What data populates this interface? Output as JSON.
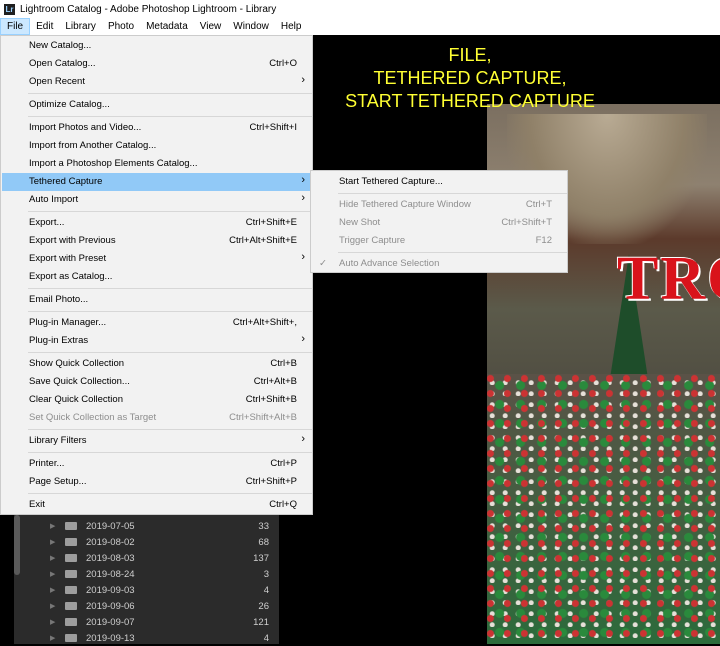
{
  "window": {
    "title": "Lightroom Catalog - Adobe Photoshop Lightroom - Library",
    "app_icon": "Lr"
  },
  "menubar": [
    {
      "label": "File"
    },
    {
      "label": "Edit"
    },
    {
      "label": "Library"
    },
    {
      "label": "Photo"
    },
    {
      "label": "Metadata"
    },
    {
      "label": "View"
    },
    {
      "label": "Window"
    },
    {
      "label": "Help"
    }
  ],
  "caption": {
    "line1": "FILE,",
    "line2": "TETHERED CAPTURE,",
    "line3": "START TETHERED CAPTURE"
  },
  "photo": {
    "banner": "TRO"
  },
  "file_menu": {
    "items": [
      {
        "label": "New Catalog...",
        "shortcut": ""
      },
      {
        "label": "Open Catalog...",
        "shortcut": "Ctrl+O"
      },
      {
        "label": "Open Recent",
        "shortcut": "",
        "submenu": "›"
      },
      {
        "label": "Optimize Catalog...",
        "shortcut": ""
      },
      {
        "label": "Import Photos and Video...",
        "shortcut": "Ctrl+Shift+I"
      },
      {
        "label": "Import from Another Catalog...",
        "shortcut": ""
      },
      {
        "label": "Import a Photoshop Elements Catalog...",
        "shortcut": ""
      },
      {
        "label": "Tethered Capture",
        "shortcut": "",
        "submenu": "›"
      },
      {
        "label": "Auto Import",
        "shortcut": "",
        "submenu": "›"
      },
      {
        "label": "Export...",
        "shortcut": "Ctrl+Shift+E"
      },
      {
        "label": "Export with Previous",
        "shortcut": "Ctrl+Alt+Shift+E"
      },
      {
        "label": "Export with Preset",
        "shortcut": "",
        "submenu": "›"
      },
      {
        "label": "Export as Catalog...",
        "shortcut": ""
      },
      {
        "label": "Email Photo...",
        "shortcut": ""
      },
      {
        "label": "Plug-in Manager...",
        "shortcut": "Ctrl+Alt+Shift+,"
      },
      {
        "label": "Plug-in Extras",
        "shortcut": "",
        "submenu": "›"
      },
      {
        "label": "Show Quick Collection",
        "shortcut": "Ctrl+B"
      },
      {
        "label": "Save Quick Collection...",
        "shortcut": "Ctrl+Alt+B"
      },
      {
        "label": "Clear Quick Collection",
        "shortcut": "Ctrl+Shift+B"
      },
      {
        "label": "Set Quick Collection as Target",
        "shortcut": "Ctrl+Shift+Alt+B"
      },
      {
        "label": "Library Filters",
        "shortcut": "",
        "submenu": "›"
      },
      {
        "label": "Printer...",
        "shortcut": "Ctrl+P"
      },
      {
        "label": "Page Setup...",
        "shortcut": "Ctrl+Shift+P"
      },
      {
        "label": "Exit",
        "shortcut": "Ctrl+Q"
      }
    ]
  },
  "tethered_submenu": {
    "items": [
      {
        "label": "Start Tethered Capture...",
        "shortcut": ""
      },
      {
        "label": "Hide Tethered Capture Window",
        "shortcut": "Ctrl+T"
      },
      {
        "label": "New Shot",
        "shortcut": "Ctrl+Shift+T"
      },
      {
        "label": "Trigger Capture",
        "shortcut": "F12"
      },
      {
        "label": "Auto Advance Selection",
        "shortcut": "",
        "check": "✓"
      }
    ]
  },
  "library_folders": [
    {
      "date": "2019-07-05",
      "count": "33"
    },
    {
      "date": "2019-08-02",
      "count": "68"
    },
    {
      "date": "2019-08-03",
      "count": "137"
    },
    {
      "date": "2019-08-24",
      "count": "3"
    },
    {
      "date": "2019-09-03",
      "count": "4"
    },
    {
      "date": "2019-09-06",
      "count": "26"
    },
    {
      "date": "2019-09-07",
      "count": "121"
    },
    {
      "date": "2019-09-13",
      "count": "4"
    }
  ]
}
